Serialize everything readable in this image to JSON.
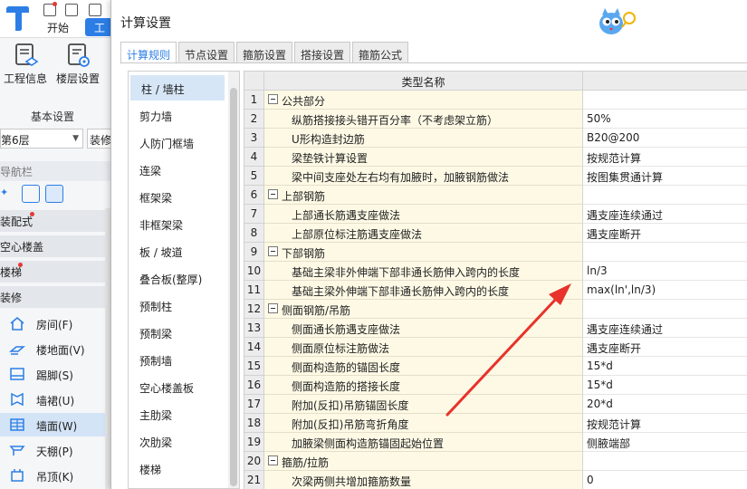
{
  "app": {
    "tab_start": "开始",
    "tab_active": "工程",
    "btn_project_info": "工程信息",
    "btn_floor_settings": "楼层设置",
    "section_basic": "基本设置",
    "floor_value": "第6层",
    "deco_btn": "装修",
    "nav_header": "导航栏",
    "nav_cats": [
      {
        "label": "装配式",
        "dot": true
      },
      {
        "label": "空心楼盖",
        "dot": false
      },
      {
        "label": "楼梯",
        "dot": true
      },
      {
        "label": "装修",
        "dot": false
      }
    ],
    "nav_items": [
      {
        "label": "房间(F)",
        "icon": "house-icon"
      },
      {
        "label": "楼地面(V)",
        "icon": "floor-icon"
      },
      {
        "label": "踢脚(S)",
        "icon": "skirting-icon"
      },
      {
        "label": "墙裙(U)",
        "icon": "dado-icon"
      },
      {
        "label": "墙面(W)",
        "icon": "wall-surface-icon"
      },
      {
        "label": "天棚(P)",
        "icon": "ceiling-icon"
      },
      {
        "label": "吊顶(K)",
        "icon": "suspended-ceiling-icon"
      }
    ]
  },
  "dialog": {
    "title": "计算设置",
    "tabs": [
      "计算规则",
      "节点设置",
      "箍筋设置",
      "搭接设置",
      "箍筋公式"
    ],
    "components": [
      "柱 / 墙柱",
      "剪力墙",
      "人防门框墙",
      "连梁",
      "框架梁",
      "非框架梁",
      "板 / 坡道",
      "叠合板(整厚)",
      "预制柱",
      "预制梁",
      "预制墙",
      "空心楼盖板",
      "主肋梁",
      "次肋梁",
      "楼梯"
    ],
    "grid_header": "类型名称",
    "rows": [
      {
        "no": "1",
        "name": "公共部分",
        "value": "",
        "group": true
      },
      {
        "no": "2",
        "name": "纵筋搭接接头错开百分率（不考虑架立筋）",
        "value": "50%",
        "group": false
      },
      {
        "no": "3",
        "name": "U形构造封边筋",
        "value": "B20@200",
        "group": false
      },
      {
        "no": "4",
        "name": "梁垫铁计算设置",
        "value": "按规范计算",
        "group": false
      },
      {
        "no": "5",
        "name": "梁中间支座处左右均有加腋时，加腋钢筋做法",
        "value": "按图集贯通计算",
        "group": false
      },
      {
        "no": "6",
        "name": "上部钢筋",
        "value": "",
        "group": true
      },
      {
        "no": "7",
        "name": "上部通长筋遇支座做法",
        "value": "遇支座连续通过",
        "group": false
      },
      {
        "no": "8",
        "name": "上部原位标注筋遇支座做法",
        "value": "遇支座断开",
        "group": false
      },
      {
        "no": "9",
        "name": "下部钢筋",
        "value": "",
        "group": true
      },
      {
        "no": "10",
        "name": "基础主梁非外伸端下部非通长筋伸入跨内的长度",
        "value": "ln/3",
        "group": false
      },
      {
        "no": "11",
        "name": "基础主梁外伸端下部非通长筋伸入跨内的长度",
        "value": "max(ln',ln/3)",
        "group": false
      },
      {
        "no": "12",
        "name": "侧面钢筋/吊筋",
        "value": "",
        "group": true
      },
      {
        "no": "13",
        "name": "侧面通长筋遇支座做法",
        "value": "遇支座连续通过",
        "group": false
      },
      {
        "no": "14",
        "name": "侧面原位标注筋做法",
        "value": "遇支座断开",
        "group": false
      },
      {
        "no": "15",
        "name": "侧面构造筋的锚固长度",
        "value": "15*d",
        "group": false
      },
      {
        "no": "16",
        "name": "侧面构造筋的搭接长度",
        "value": "15*d",
        "group": false
      },
      {
        "no": "17",
        "name": "附加(反扣)吊筋锚固长度",
        "value": "20*d",
        "group": false
      },
      {
        "no": "18",
        "name": "附加(反扣)吊筋弯折角度",
        "value": "按规范计算",
        "group": false
      },
      {
        "no": "19",
        "name": "加腋梁侧面构造筋锚固起始位置",
        "value": "侧腋端部",
        "group": false
      },
      {
        "no": "20",
        "name": "箍筋/拉筋",
        "value": "",
        "group": true
      },
      {
        "no": "21",
        "name": "次梁两侧共增加箍筋数量",
        "value": "0",
        "group": false
      }
    ]
  },
  "colors": {
    "accent": "#2c7ee6",
    "name_cell_bg": "#fdf9e5",
    "annotation_arrow": "#e8322b"
  }
}
